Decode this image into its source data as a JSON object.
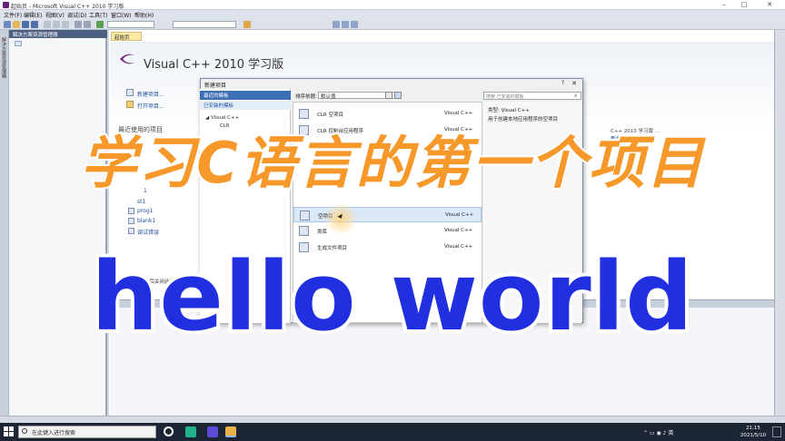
{
  "window": {
    "title": "起始页 - Microsoft Visual C++ 2010 学习版",
    "min": "–",
    "max": "□",
    "close": "✕"
  },
  "menu": [
    "文件(F)",
    "编辑(E)",
    "视图(V)",
    "调试(D)",
    "工具(T)",
    "窗口(W)",
    "帮助(H)"
  ],
  "solution_explorer": {
    "title": "解决方案资源管理器",
    "side_tab": "解决方案资源管理器"
  },
  "doc_tab": "起始页",
  "start_page": {
    "product": "Visual C++ 2010 学习版",
    "new_project": "新建项目...",
    "open_project": "打开项目...",
    "recent_title": "最近使用的项目",
    "recent_items": [
      "1",
      "st1",
      "prog1",
      "blank1",
      "调试错误"
    ],
    "close_option": "在项目加载后关闭此页",
    "right_snippet1": "C++ 2010 学习版 ...",
    "right_snippet2": "新增功能"
  },
  "dialog": {
    "title": "新建项目",
    "help": "?",
    "close": "✕",
    "recent_templates": "最近的模板",
    "installed_templates": "已安装的模板",
    "tree": [
      "Visual C++",
      "CLR"
    ],
    "sort_label": "排序依据:",
    "sort_value": "默认值",
    "search_placeholder": "搜索 已安装的模板",
    "templates": [
      {
        "name": "CLR 空项目",
        "lang": "Visual C++"
      },
      {
        "name": "CLR 控制台应用程序",
        "lang": "Visual C++"
      },
      {
        "name": "空项目",
        "lang": "Visual C++"
      },
      {
        "name": "类库",
        "lang": "Visual C++"
      },
      {
        "name": "生成文件项目",
        "lang": "Visual C++"
      }
    ],
    "desc_type": "类型: Visual C++",
    "desc_text": "用于创建本地应用程序的空项目"
  },
  "overlay": {
    "title": "学习C语言的第一个项目",
    "subtitle": "hello world"
  },
  "taskbar": {
    "search_placeholder": "在此键入进行搜索",
    "time": "21:15",
    "date": "2021/5/10"
  },
  "colors": {
    "overlay_orange": "#f7982a",
    "overlay_blue": "#2030e0",
    "vs_purple": "#68217a"
  }
}
